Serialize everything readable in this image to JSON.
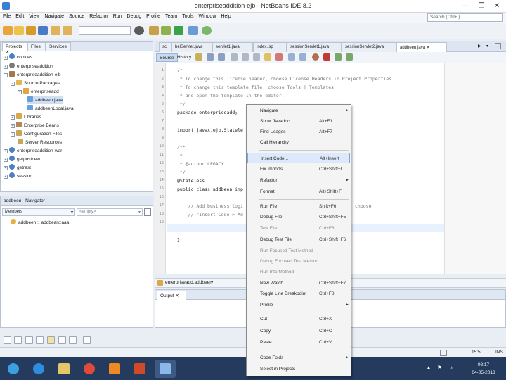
{
  "window": {
    "title": "enterpriseaddition-ejb - NetBeans IDE 8.2",
    "min": "—",
    "max": "❐",
    "close": "✕"
  },
  "menu": [
    "File",
    "Edit",
    "View",
    "Navigate",
    "Source",
    "Refactor",
    "Run",
    "Debug",
    "Profile",
    "Team",
    "Tools",
    "Window",
    "Help"
  ],
  "search": {
    "placeholder": "Search (Ctrl+I)"
  },
  "projects": {
    "tabs": [
      "Projects",
      "Files",
      "Services"
    ],
    "tab_close": "✕",
    "tree": [
      "cookies",
      "enterpriseaddition",
      "enterpriseaddition-ejb",
      "Source Packages",
      "enterpriseadd",
      "addbeen.java",
      "addbeenLocal.java",
      "Libraries",
      "Enterprise Beans",
      "Configuration Files",
      "Server Resources",
      "enterpriseaddition-war",
      "getpostnew",
      "getrest",
      "session"
    ]
  },
  "navigator": {
    "title": "addbeen - Navigator",
    "members": "Members",
    "filter": "<empty>",
    "item": "addbeen :: addbean::aaa"
  },
  "editor": {
    "tabs": [
      "sc",
      "helServlet.java",
      "servlet1.java",
      "index.jsp",
      "sessionServlet1.java",
      "sessionServlet2.java",
      "addbeen.java"
    ],
    "tab_close": "✕",
    "source_tab": "Source",
    "history_tab": "History",
    "line_numbers": [
      "1",
      "2",
      "3",
      "4",
      "5",
      "6",
      "7",
      "8",
      "9",
      "10",
      "11",
      "12",
      "13",
      "14",
      "15",
      "16",
      "17",
      "18",
      "19"
    ],
    "code": [
      "/*",
      " * To change this license header, choose License Headers in Project Properties.",
      " * To change this template file, choose Tools | Templates",
      " * and open the template in the editor.",
      " */",
      "package enterpriseadd;",
      "",
      "import javax.ejb.Statele",
      "",
      "/**",
      " *",
      " * @author LEGACY",
      " */",
      "@Stateless",
      "public class addbeen imp",
      "",
      "    // Add business logi",
      "    // \"Insert Code > Ad",
      "",
      "}"
    ],
    "code_tail": "choose"
  },
  "breadcrumb": {
    "text": "enterpriseadd.addbeen"
  },
  "output": {
    "title": "Output",
    "close": "✕"
  },
  "status": {
    "position": "15:5",
    "mode": "INS"
  },
  "taskbar": {
    "time": "08:17",
    "date": "04-05-2018"
  },
  "context_menu": {
    "items": [
      {
        "label": "Navigate",
        "shortcut": "",
        "submenu": true
      },
      {
        "label": "Show Javadoc",
        "shortcut": "Alt+F1"
      },
      {
        "label": "Find Usages",
        "shortcut": "Alt+F7"
      },
      {
        "label": "Call Hierarchy",
        "shortcut": ""
      },
      {
        "label": "Insert Code...",
        "shortcut": "Alt+Insert",
        "highlighted": true
      },
      {
        "label": "Fix Imports",
        "shortcut": "Ctrl+Shift+I"
      },
      {
        "label": "Refactor",
        "shortcut": "",
        "submenu": true
      },
      {
        "label": "Format",
        "shortcut": "Alt+Shift+F"
      },
      {
        "label": "Run File",
        "shortcut": "Shift+F6"
      },
      {
        "label": "Debug File",
        "shortcut": "Ctrl+Shift+F5"
      },
      {
        "label": "Test File",
        "shortcut": "Ctrl+F6",
        "disabled": true
      },
      {
        "label": "Debug Test File",
        "shortcut": "Ctrl+Shift+F6"
      },
      {
        "label": "Run Focused Test Method",
        "shortcut": "",
        "disabled": true
      },
      {
        "label": "Debug Focused Test Method",
        "shortcut": "",
        "disabled": true
      },
      {
        "label": "Run Into Method",
        "shortcut": "",
        "disabled": true
      },
      {
        "label": "New Watch...",
        "shortcut": "Ctrl+Shift+F7"
      },
      {
        "label": "Toggle Line Breakpoint",
        "shortcut": "Ctrl+F8"
      },
      {
        "label": "Profile",
        "shortcut": "",
        "submenu": true
      },
      {
        "label": "Cut",
        "shortcut": "Ctrl+X"
      },
      {
        "label": "Copy",
        "shortcut": "Ctrl+C"
      },
      {
        "label": "Paste",
        "shortcut": "Ctrl+V"
      },
      {
        "label": "Code Folds",
        "shortcut": "",
        "submenu": true
      },
      {
        "label": "Select in Projects",
        "shortcut": ""
      }
    ]
  },
  "icons": {
    "submenu_arrow": "▶",
    "dropdown": "▾",
    "flag": "⚑",
    "speaker": "♪",
    "tray_up": "▲"
  },
  "colors": {
    "accent": "#3a7fd5",
    "taskbar": "#243b5e",
    "highlight": "#dbe9fb"
  }
}
